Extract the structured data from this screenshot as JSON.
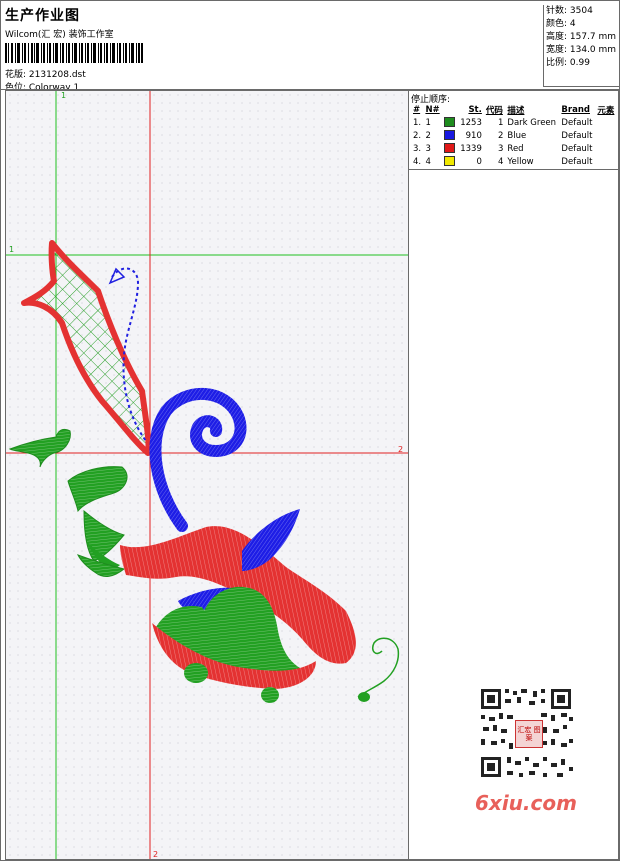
{
  "header": {
    "title": "生产作业图",
    "subtitle": "Wilcom(汇 宏) 装饰工作室",
    "design_label": "花版: 2131208.dst",
    "colorway_label": "色位: Colorway 1"
  },
  "stats": {
    "stitches": "针数: 3504",
    "colors": "颜色: 4",
    "height": "高度: 157.7 mm",
    "width": "宽度: 134.0 mm",
    "scale": "比例: 0.99"
  },
  "sequence": {
    "title": "停止顺序:",
    "columns": [
      "#",
      "N#",
      "St.",
      "代码",
      "描述",
      "Brand",
      "元素"
    ],
    "rows": [
      {
        "idx": "1.",
        "n": "1",
        "color": "#1e8c1e",
        "st": "1253",
        "code": "1",
        "desc": "Dark Green",
        "brand": "Default"
      },
      {
        "idx": "2.",
        "n": "2",
        "color": "#1818e0",
        "st": "910",
        "code": "2",
        "desc": "Blue",
        "brand": "Default"
      },
      {
        "idx": "3.",
        "n": "3",
        "color": "#e01818",
        "st": "1339",
        "code": "3",
        "desc": "Red",
        "brand": "Default"
      },
      {
        "idx": "4.",
        "n": "4",
        "color": "#f0e800",
        "st": "0",
        "code": "4",
        "desc": "Yellow",
        "brand": "Default"
      }
    ]
  },
  "guides": {
    "v1_label": "1",
    "h1_label": "1",
    "h2_label": "2",
    "v2_label": "2"
  },
  "qr_badge": "汇宏 图案",
  "watermark": "6xiu.com"
}
